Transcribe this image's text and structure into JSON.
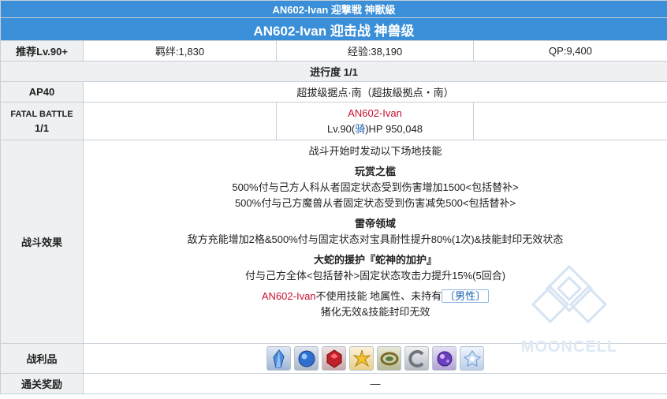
{
  "header": {
    "title_jp": "AN602-Ivan 迎撃戦 神獣級",
    "title_cn": "AN602-Ivan 迎击战 神兽级"
  },
  "stats": {
    "recommend": "推荐Lv.90+",
    "bond": "羁绊:1,830",
    "exp": "经验:38,190",
    "qp": "QP:9,400"
  },
  "progress": "进行度 1/1",
  "ap": "AP40",
  "location": "超拔级据点·南（超抜級拠点・南）",
  "fatal": {
    "label_line1": "FATAL BATTLE",
    "label_line2": "1/1",
    "enemy_name": "AN602-Ivan",
    "enemy_lv_prefix": "Lv.90(",
    "enemy_class": "骑",
    "enemy_hp_suffix": ")HP 950,048"
  },
  "effects": {
    "label": "战斗效果",
    "intro": "战斗开始时发动以下场地技能",
    "skills": [
      {
        "title": "玩赏之槛",
        "lines": [
          "500%付与己方人科从者固定状态受到伤害增加1500<包括替补>",
          "500%付与己方魔兽从者固定状态受到伤害减免500<包括替补>"
        ]
      },
      {
        "title": "雷帝领域",
        "lines": [
          "敌方充能增加2格&500%付与固定状态对宝具耐性提升80%(1次)&技能封印无效状态"
        ]
      },
      {
        "title": "大蛇的援护『蛇神的加护』",
        "lines": [
          "付与己方全体<包括替补>固定状态攻击力提升15%(5回合)"
        ]
      }
    ],
    "note_name": "AN602-Ivan",
    "note_mid": "不使用技能 地属性、未持有",
    "note_gender": "〔男性〕",
    "note_line2": "猪化无效&技能封印无效"
  },
  "drops": {
    "label": "战利品",
    "items": [
      {
        "icon": "blue-crystal-icon",
        "color": "#4f8fdc"
      },
      {
        "icon": "blue-gem-icon",
        "color": "#2f6fd0"
      },
      {
        "icon": "red-gem-icon",
        "color": "#c0202a"
      },
      {
        "icon": "golden-burst-icon",
        "color": "#e8b020"
      },
      {
        "icon": "bronze-ring-icon",
        "color": "#8a7a3a"
      },
      {
        "icon": "silver-crescent-icon",
        "color": "#9aa0a8"
      },
      {
        "icon": "purple-orb-icon",
        "color": "#6a40c0"
      },
      {
        "icon": "frost-crystal-icon",
        "color": "#a8c8f0"
      }
    ]
  },
  "clear_reward": {
    "label": "通关奖励",
    "value": "—"
  },
  "watermark": "MOONCELL"
}
